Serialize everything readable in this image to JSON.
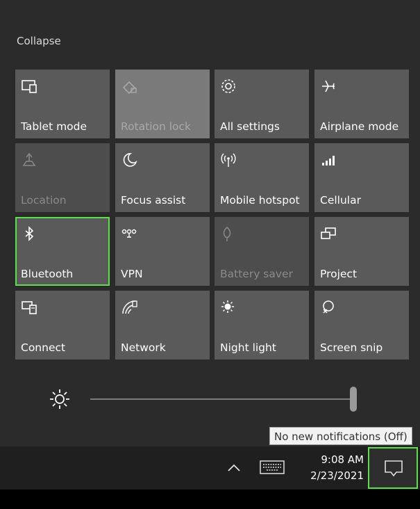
{
  "panel": {
    "collapse_label": "Collapse",
    "tiles": [
      {
        "label": "Tablet mode",
        "icon": "tablet-mode-icon",
        "state": "on"
      },
      {
        "label": "Rotation lock",
        "icon": "rotation-lock-icon",
        "state": "disabled-light"
      },
      {
        "label": "All settings",
        "icon": "gear-icon",
        "state": "on"
      },
      {
        "label": "Airplane mode",
        "icon": "airplane-icon",
        "state": "on"
      },
      {
        "label": "Location",
        "icon": "location-icon",
        "state": "disabled"
      },
      {
        "label": "Focus assist",
        "icon": "moon-icon",
        "state": "on"
      },
      {
        "label": "Mobile hotspot",
        "icon": "hotspot-icon",
        "state": "on"
      },
      {
        "label": "Cellular",
        "icon": "cellular-icon",
        "state": "on"
      },
      {
        "label": "Bluetooth",
        "icon": "bluetooth-icon",
        "state": "on",
        "selected": true
      },
      {
        "label": "VPN",
        "icon": "vpn-icon",
        "state": "on"
      },
      {
        "label": "Battery saver",
        "icon": "battery-saver-icon",
        "state": "disabled"
      },
      {
        "label": "Project",
        "icon": "project-icon",
        "state": "on"
      },
      {
        "label": "Connect",
        "icon": "connect-icon",
        "state": "on"
      },
      {
        "label": "Network",
        "icon": "network-icon",
        "state": "on"
      },
      {
        "label": "Night light",
        "icon": "night-light-icon",
        "state": "on"
      },
      {
        "label": "Screen snip",
        "icon": "screen-snip-icon",
        "state": "on"
      }
    ],
    "brightness_level": 1.0
  },
  "tooltip": "No new notifications (Off)",
  "taskbar": {
    "time": "9:08 AM",
    "date": "2/23/2021"
  },
  "colors": {
    "highlight": "#5be14a",
    "tile": "#5a5a5a",
    "background": "#2b2b2b"
  }
}
